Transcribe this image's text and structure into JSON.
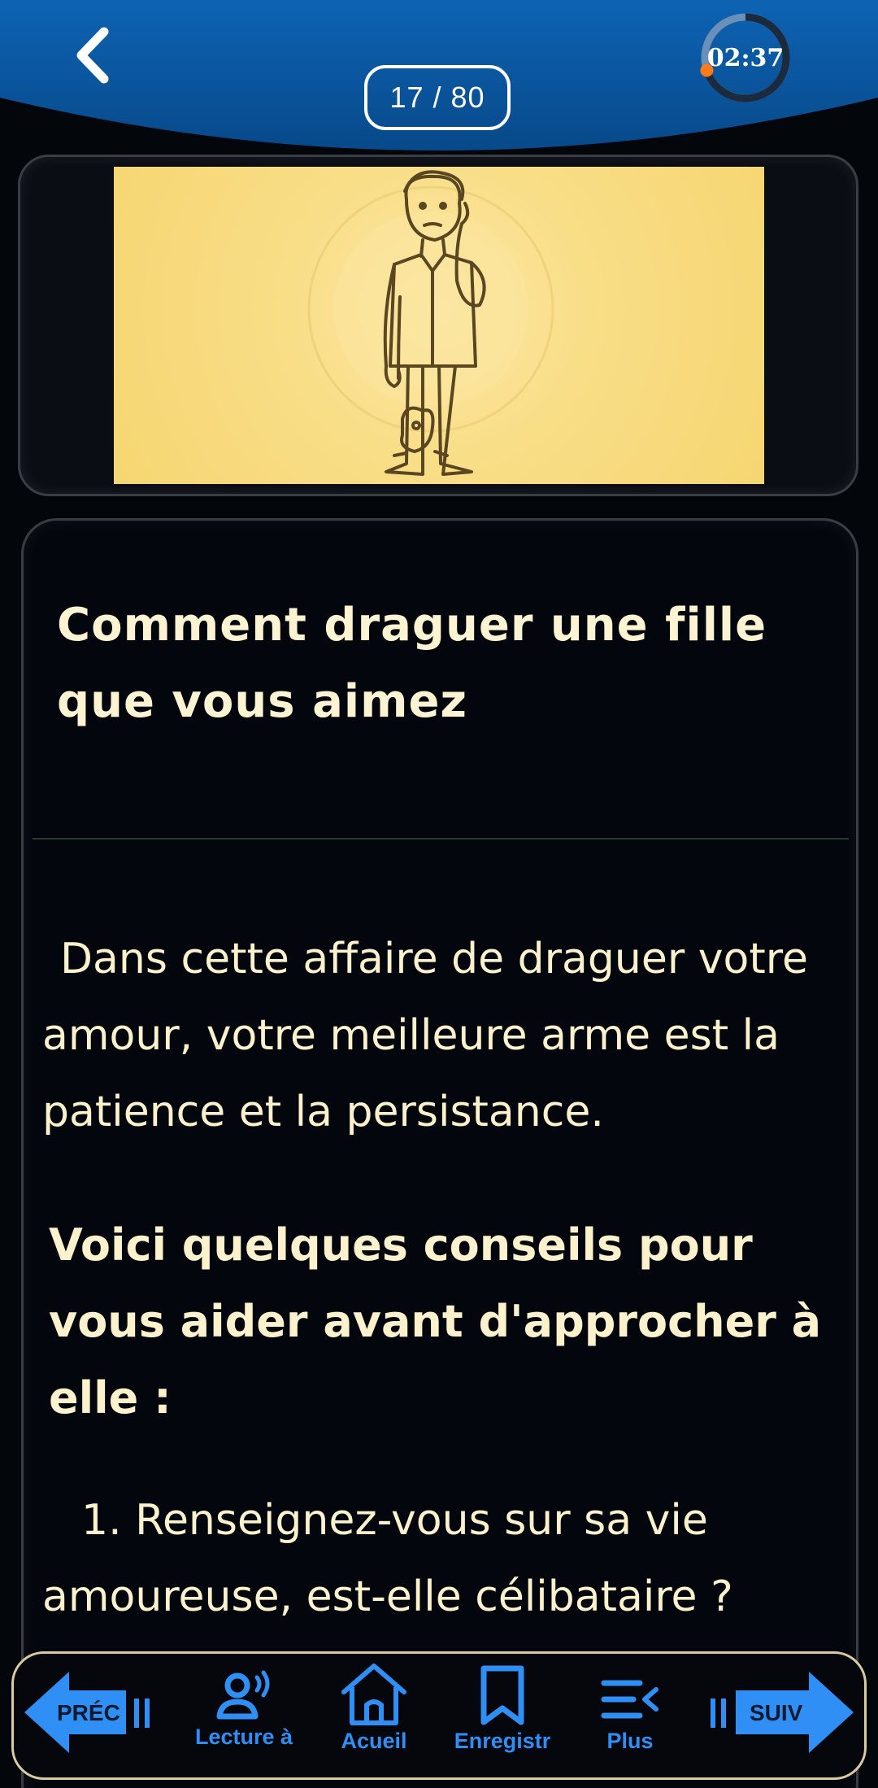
{
  "header": {
    "page_counter": "17 / 80",
    "timer": "02:37",
    "timer_progress": 0.7,
    "accent_color": "#0b5aa5",
    "timer_dot_color": "#ff7a1a"
  },
  "illustration": {
    "description_icon": "worried-man-with-dog-icon",
    "background_color": "#f8dc84"
  },
  "article": {
    "title": "Comment draguer une fille que vous aimez",
    "paragraph_1": "Dans cette affaire de draguer votre amour, votre meilleure arme est la patience et la persistance.",
    "paragraph_2": "Voici quelques conseils pour vous aider avant d'approcher à elle :",
    "paragraph_3": "1. Renseignez-vous sur sa vie amoureuse, est-elle célibataire ?"
  },
  "bottom_nav": {
    "prev_label": "PRÉC",
    "next_label": "SUIV",
    "items": [
      {
        "label": "Lecture à",
        "icon": "voice-reader-icon"
      },
      {
        "label": "Acueil",
        "icon": "home-icon"
      },
      {
        "label": "Enregistr",
        "icon": "bookmark-icon"
      },
      {
        "label": "Plus",
        "icon": "more-list-icon"
      }
    ],
    "nav_color": "#2f8ff5"
  }
}
